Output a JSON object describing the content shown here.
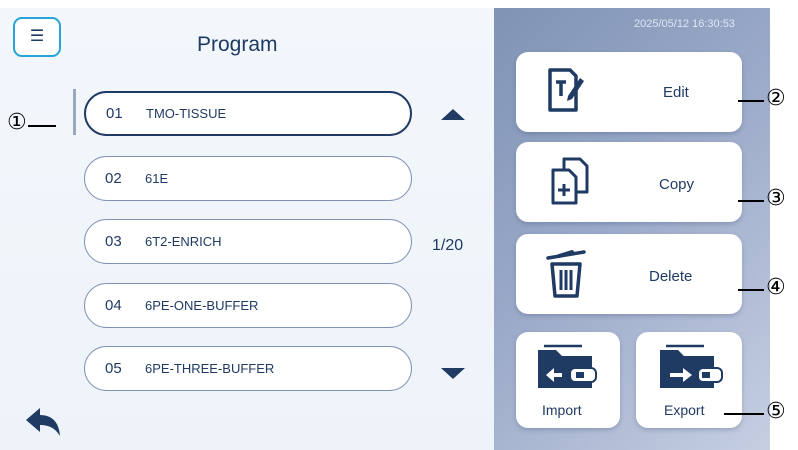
{
  "header": {
    "menu_icon": "hamburger-menu-icon",
    "title": "Program",
    "timestamp": "2025/05/12  16:30:53"
  },
  "programs": [
    {
      "num": "01",
      "name": "TMO-TISSUE",
      "selected": true
    },
    {
      "num": "02",
      "name": "61E",
      "selected": false
    },
    {
      "num": "03",
      "name": "6T2-ENRICH",
      "selected": false
    },
    {
      "num": "04",
      "name": "6PE-ONE-BUFFER",
      "selected": false
    },
    {
      "num": "05",
      "name": "6PE-THREE-BUFFER",
      "selected": false
    }
  ],
  "pagination": {
    "indicator": "1/20"
  },
  "actions": {
    "edit_label": "Edit",
    "copy_label": "Copy",
    "delete_label": "Delete",
    "import_label": "Import",
    "export_label": "Export"
  },
  "callouts": [
    "①",
    "②",
    "③",
    "④",
    "⑤"
  ],
  "colors": {
    "navy": "#1f3a63",
    "accent_border": "#27a3d6",
    "panel_right": "#8fa0c0"
  }
}
